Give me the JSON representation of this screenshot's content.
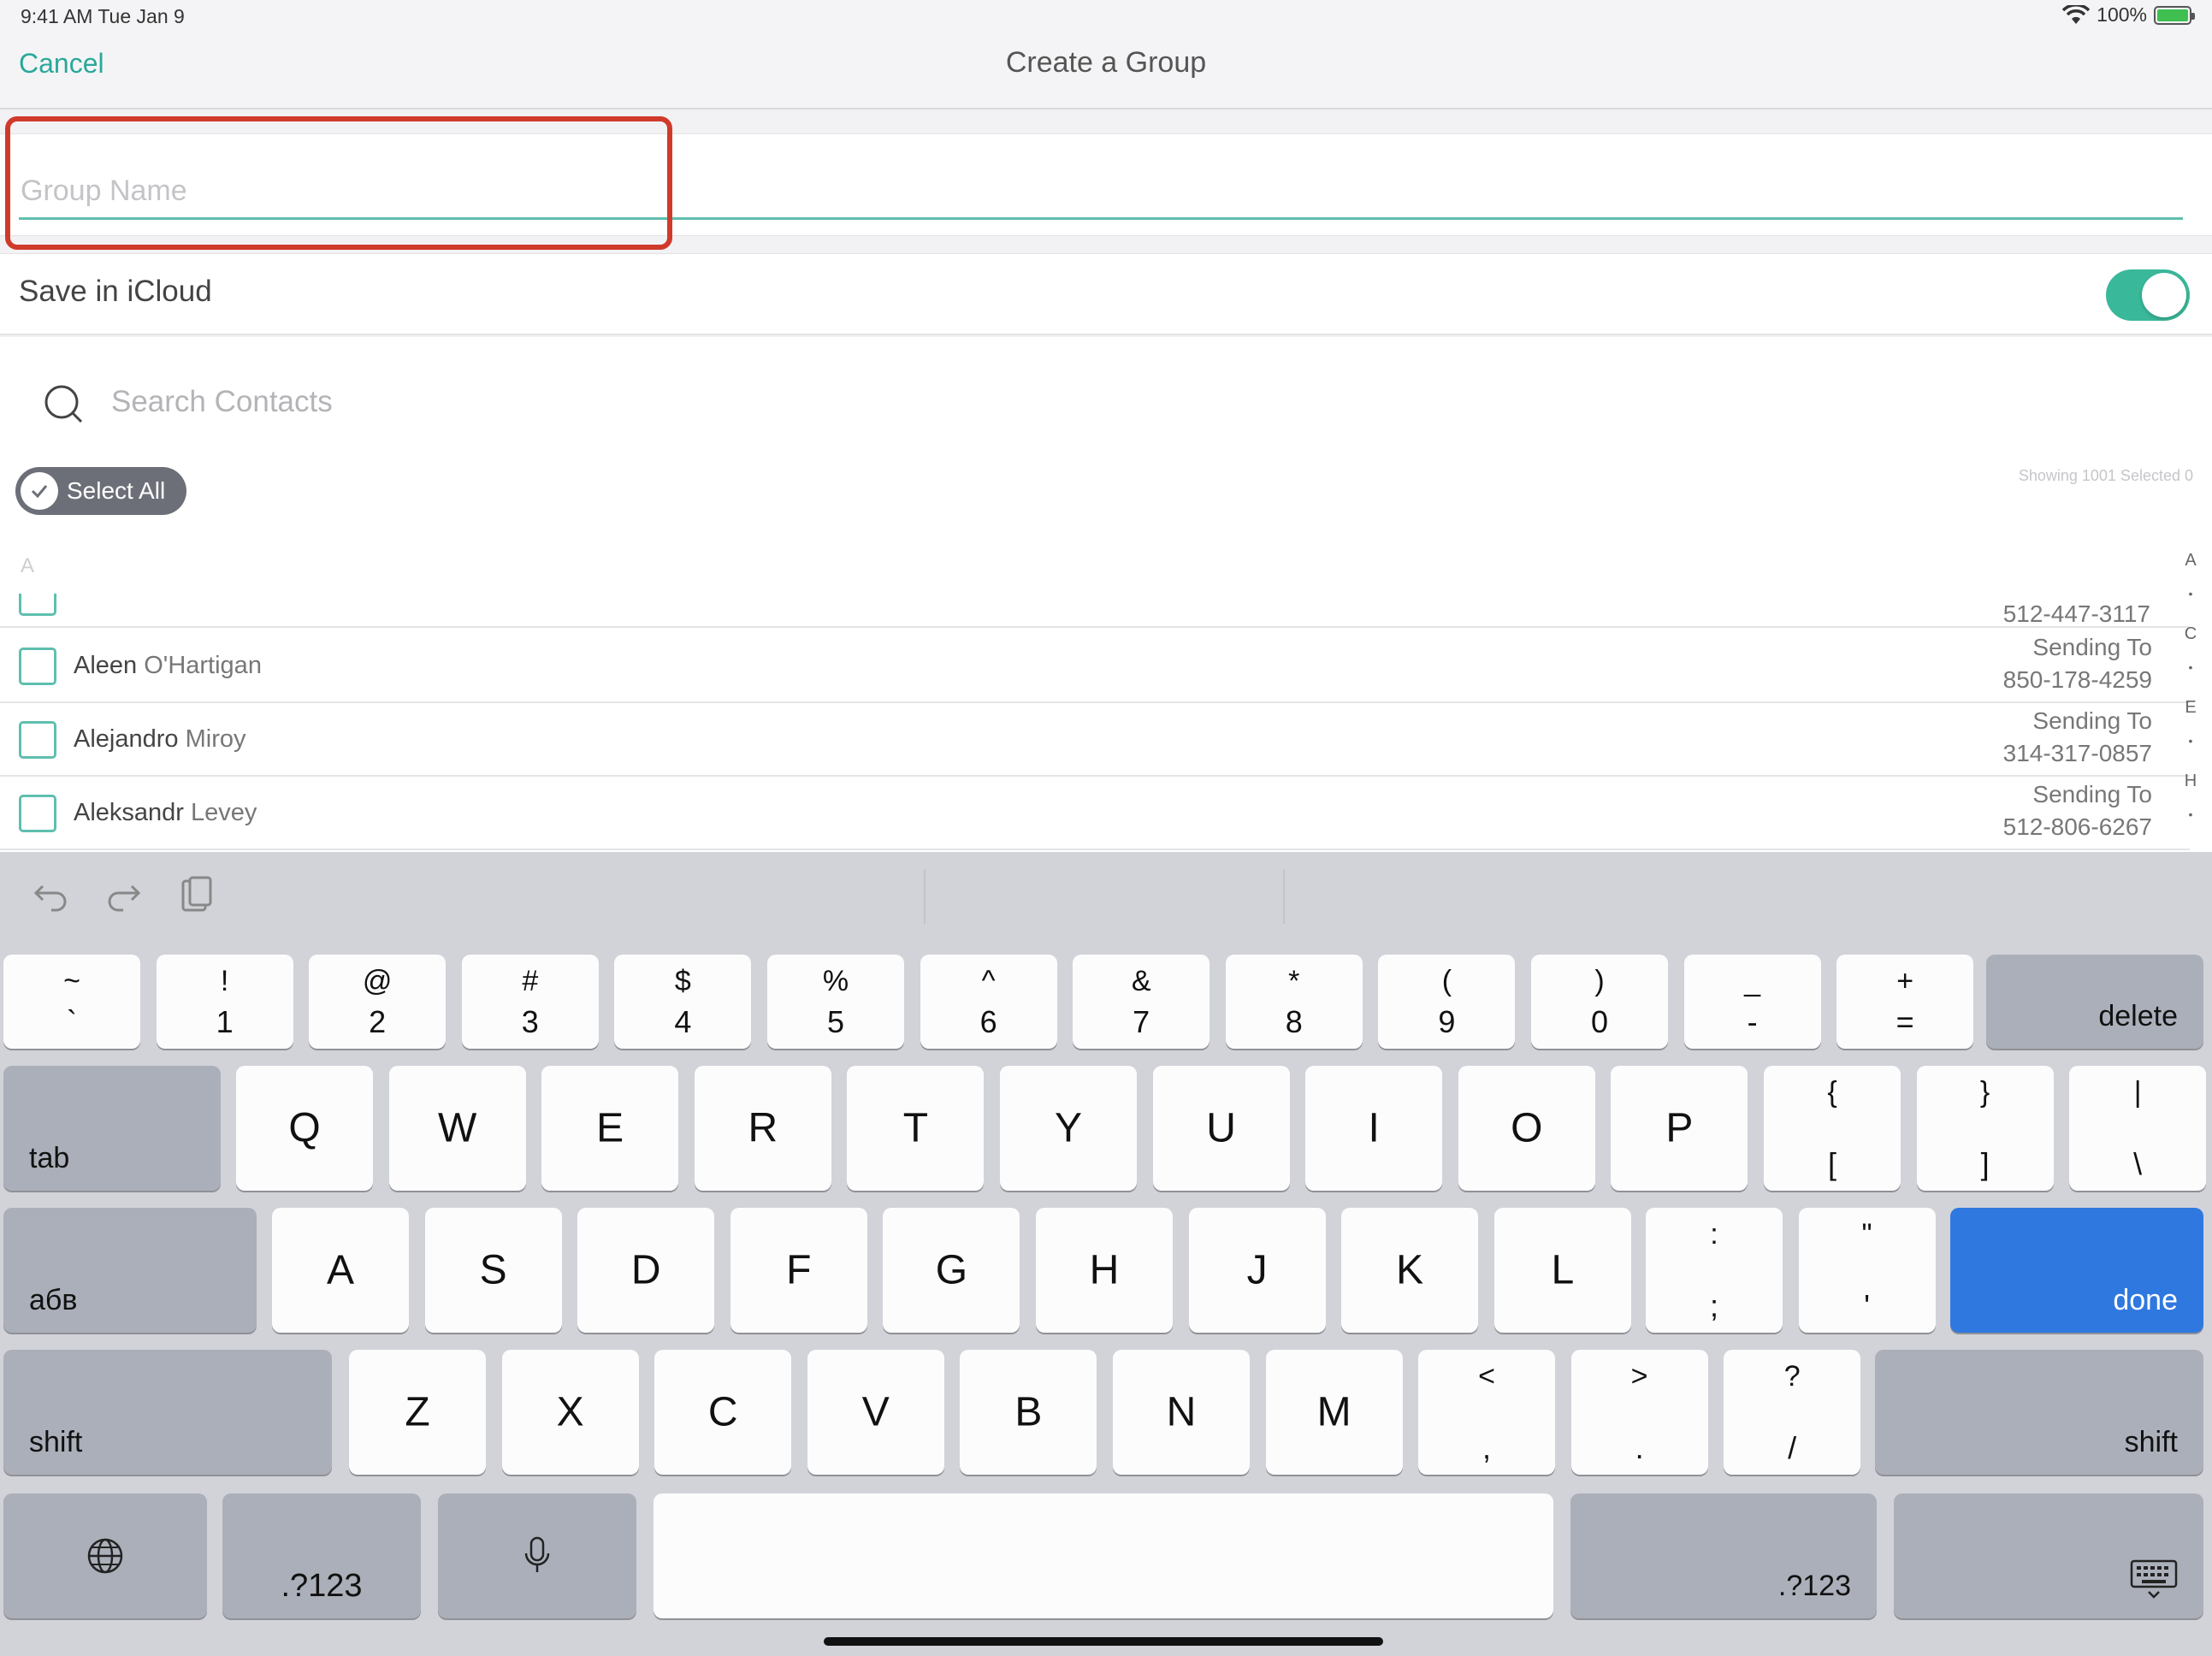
{
  "status": {
    "time_date": "9:41 AM   Tue Jan 9",
    "battery": "100%"
  },
  "nav": {
    "cancel_label": "Cancel",
    "title": "Create a Group"
  },
  "group": {
    "placeholder": "Group Name",
    "value": ""
  },
  "icloud": {
    "label": "Save in iCloud",
    "enabled": true
  },
  "search": {
    "placeholder": "Search Contacts"
  },
  "select_all": {
    "label": "Select All"
  },
  "showing": {
    "text": "Showing 1001   Selected 0"
  },
  "section": {
    "letter": "A"
  },
  "partial_row": {
    "phone": "512-447-3117"
  },
  "contacts": [
    {
      "first": "Aleen",
      "last": "O'Hartigan",
      "sending_label": "Sending To",
      "phone": "850-178-4259"
    },
    {
      "first": "Alejandro",
      "last": "Miroy",
      "sending_label": "Sending To",
      "phone": "314-317-0857"
    },
    {
      "first": "Aleksandr",
      "last": "Levey",
      "sending_label": "Sending To",
      "phone": "512-806-6267"
    }
  ],
  "index_letters": [
    "A",
    "•",
    "C",
    "•",
    "E",
    "•",
    "H",
    "•"
  ],
  "keyboard": {
    "row1": [
      {
        "top": "~",
        "bot": "`"
      },
      {
        "top": "!",
        "bot": "1"
      },
      {
        "top": "@",
        "bot": "2"
      },
      {
        "top": "#",
        "bot": "3"
      },
      {
        "top": "$",
        "bot": "4"
      },
      {
        "top": "%",
        "bot": "5"
      },
      {
        "top": "^",
        "bot": "6"
      },
      {
        "top": "&",
        "bot": "7"
      },
      {
        "top": "*",
        "bot": "8"
      },
      {
        "top": "(",
        "bot": "9"
      },
      {
        "top": ")",
        "bot": "0"
      },
      {
        "top": "_",
        "bot": "-"
      },
      {
        "top": "+",
        "bot": "="
      }
    ],
    "delete": "delete",
    "tab": "tab",
    "row2": [
      "Q",
      "W",
      "E",
      "R",
      "T",
      "Y",
      "U",
      "I",
      "O",
      "P"
    ],
    "row2_sym": [
      {
        "top": "{",
        "bot": "["
      },
      {
        "top": "}",
        "bot": "]"
      },
      {
        "top": "|",
        "bot": "\\"
      }
    ],
    "abc": "абв",
    "row3": [
      "A",
      "S",
      "D",
      "F",
      "G",
      "H",
      "J",
      "K",
      "L"
    ],
    "row3_sym": [
      {
        "top": ":",
        "bot": ";"
      },
      {
        "top": "\"",
        "bot": "'"
      }
    ],
    "done": "done",
    "shift": "shift",
    "row4": [
      "Z",
      "X",
      "C",
      "V",
      "B",
      "N",
      "M"
    ],
    "row4_sym": [
      {
        "top": "<",
        "bot": ","
      },
      {
        "top": ">",
        "bot": "."
      },
      {
        "top": "?",
        "bot": "/"
      }
    ],
    "num_toggle": ".?123"
  },
  "icons": {
    "wifi": "wifi-icon",
    "battery": "battery-icon",
    "search": "search-icon",
    "undo": "undo-icon",
    "redo": "redo-icon",
    "paste": "clipboard-icon",
    "globe": "globe-icon",
    "mic": "microphone-icon",
    "hide_keyboard": "keyboard-hide-icon"
  },
  "colors": {
    "accent": "#2aa89a",
    "toggle_on": "#3ab89a",
    "highlight": "#d03a2b",
    "done_key": "#2f78df"
  }
}
